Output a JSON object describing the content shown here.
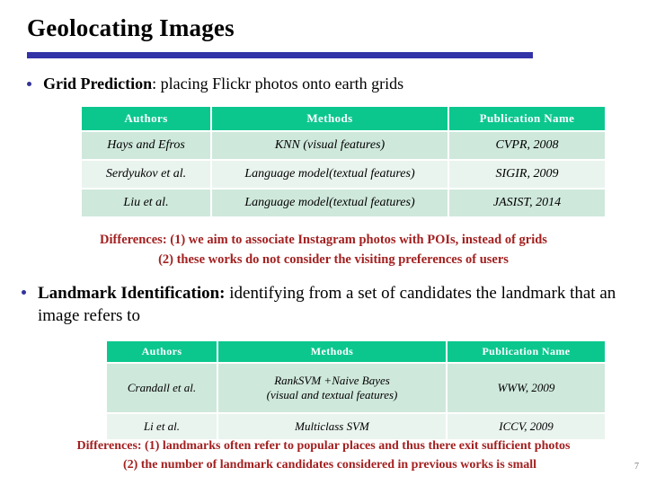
{
  "slide": {
    "title": "Geolocating Images",
    "page_number": "7",
    "accent_bar_color": "#3333a8",
    "table_header_color": "#0bc78e",
    "table_row_color": "#cfe8dc",
    "note_color": "#a32020"
  },
  "bullets": {
    "grid_prediction": {
      "lead": "Grid Prediction",
      "rest": ": placing Flickr photos onto earth grids"
    },
    "landmark_identification": {
      "lead": "Landmark Identification:",
      "rest": " identifying from a set of candidates the landmark that an image refers to"
    }
  },
  "tables": {
    "grid_prediction": {
      "columns": [
        "Authors",
        "Methods",
        "Publication Name"
      ],
      "rows": [
        {
          "authors": "Hays and Efros",
          "methods": "KNN (visual features)",
          "methods_line2": "",
          "publication": "CVPR, 2008"
        },
        {
          "authors": "Serdyukov et al.",
          "methods": "Language model(textual features)",
          "methods_line2": "",
          "publication": "SIGIR, 2009"
        },
        {
          "authors": "Liu et al.",
          "methods": "Language model(textual features)",
          "methods_line2": "",
          "publication": "JASIST, 2014"
        }
      ]
    },
    "landmark_identification": {
      "columns": [
        "Authors",
        "Methods",
        "Publication Name"
      ],
      "rows": [
        {
          "authors": "Crandall et al.",
          "methods": "RankSVM +Naive Bayes",
          "methods_line2": "(visual and textual features)",
          "publication": "WWW, 2009"
        },
        {
          "authors": "Li et al.",
          "methods": "Multiclass SVM",
          "methods_line2": "",
          "publication": "ICCV, 2009"
        }
      ]
    }
  },
  "notes": {
    "grid_prediction": {
      "line1": "Differences: (1) we aim to associate Instagram photos with POIs, instead of grids",
      "line2": "(2)  these works do not consider the visiting preferences of users"
    },
    "landmark_identification": {
      "line1": "Differences: (1) landmarks often refer to popular places and thus there exit sufficient photos",
      "line2": "(2) the number of landmark candidates considered in previous works is small"
    }
  }
}
